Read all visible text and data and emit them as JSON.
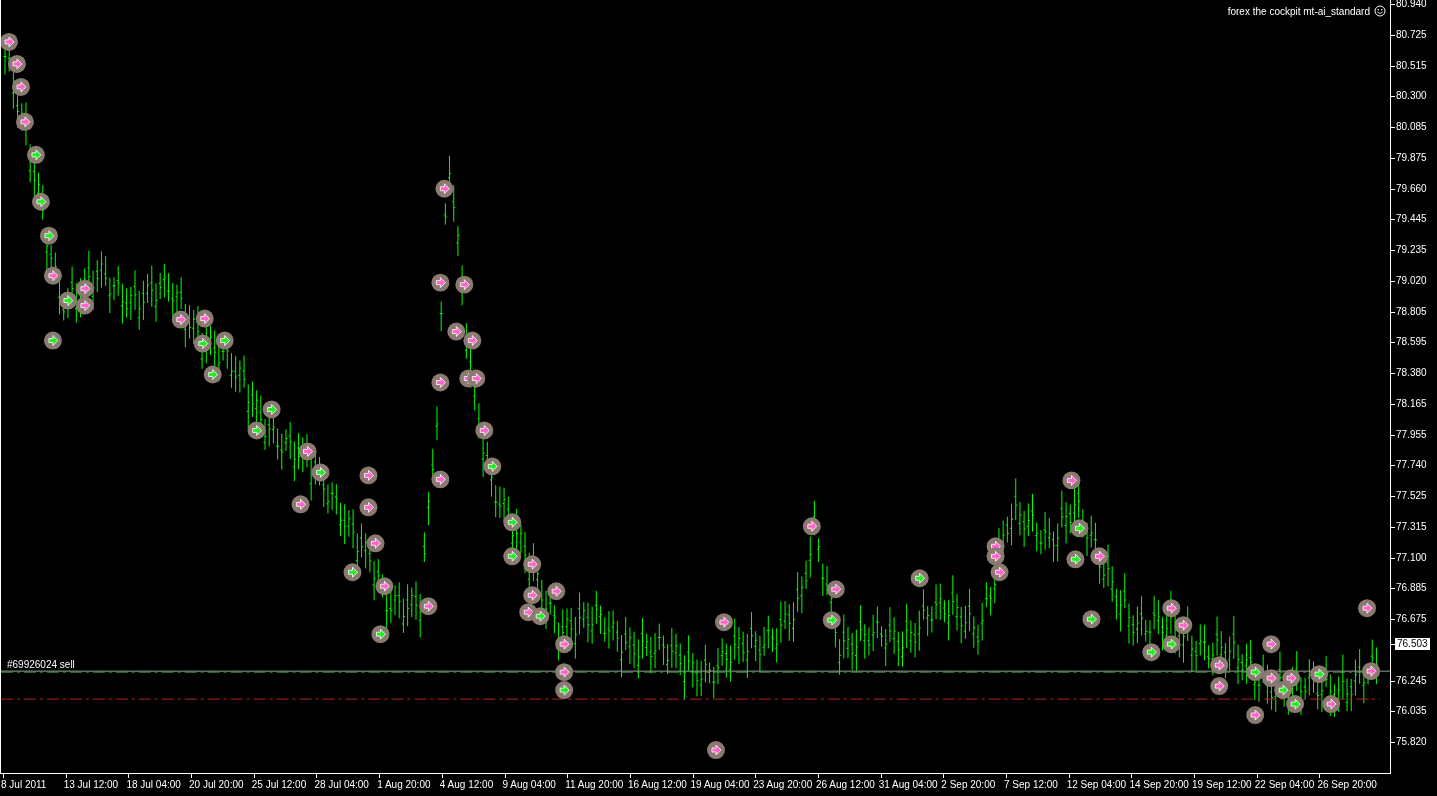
{
  "chart": {
    "title": "forex the cockpit mt-ai_standard",
    "order_label": "#69926024 sell",
    "price_axis": [
      {
        "kind": "tick",
        "label": "80.940"
      },
      {
        "kind": "tick",
        "label": "80.725"
      },
      {
        "kind": "tick",
        "label": "80.515"
      },
      {
        "kind": "tick",
        "label": "80.300"
      },
      {
        "kind": "tick",
        "label": "80.085"
      },
      {
        "kind": "tick",
        "label": "79.875"
      },
      {
        "kind": "tick",
        "label": "79.660"
      },
      {
        "kind": "tick",
        "label": "79.445"
      },
      {
        "kind": "tick",
        "label": "79.235"
      },
      {
        "kind": "tick",
        "label": "79.020"
      },
      {
        "kind": "tick",
        "label": "78.805"
      },
      {
        "kind": "tick",
        "label": "78.595"
      },
      {
        "kind": "tick",
        "label": "78.380"
      },
      {
        "kind": "tick",
        "label": "78.165"
      },
      {
        "kind": "tick",
        "label": "77.955"
      },
      {
        "kind": "tick",
        "label": "77.740"
      },
      {
        "kind": "tick",
        "label": "77.525"
      },
      {
        "kind": "tick",
        "label": "77.315"
      },
      {
        "kind": "tick",
        "label": "77.100"
      },
      {
        "kind": "tick",
        "label": "76.885"
      },
      {
        "kind": "tick",
        "label": "76.675"
      },
      {
        "kind": "price",
        "label": "76.503"
      },
      {
        "kind": "tick",
        "label": "76.245"
      },
      {
        "kind": "tick",
        "label": "76.035"
      },
      {
        "kind": "tick",
        "label": "75.820"
      }
    ],
    "time_axis": [
      "8 Jul 2011",
      "13 Jul 12:00",
      "18 Jul 04:00",
      "20 Jul 20:00",
      "25 Jul 12:00",
      "28 Jul 04:00",
      "1 Aug 20:00",
      "4 Aug 12:00",
      "9 Aug 04:00",
      "11 Aug 20:00",
      "16 Aug 12:00",
      "19 Aug 04:00",
      "23 Aug 20:00",
      "26 Aug 12:00",
      "31 Aug 04:00",
      "2 Sep 20:00",
      "7 Sep 12:00",
      "12 Sep 04:00",
      "14 Sep 20:00",
      "19 Sep 12:00",
      "22 Sep 04:00",
      "26 Sep 20:00"
    ]
  }
}
